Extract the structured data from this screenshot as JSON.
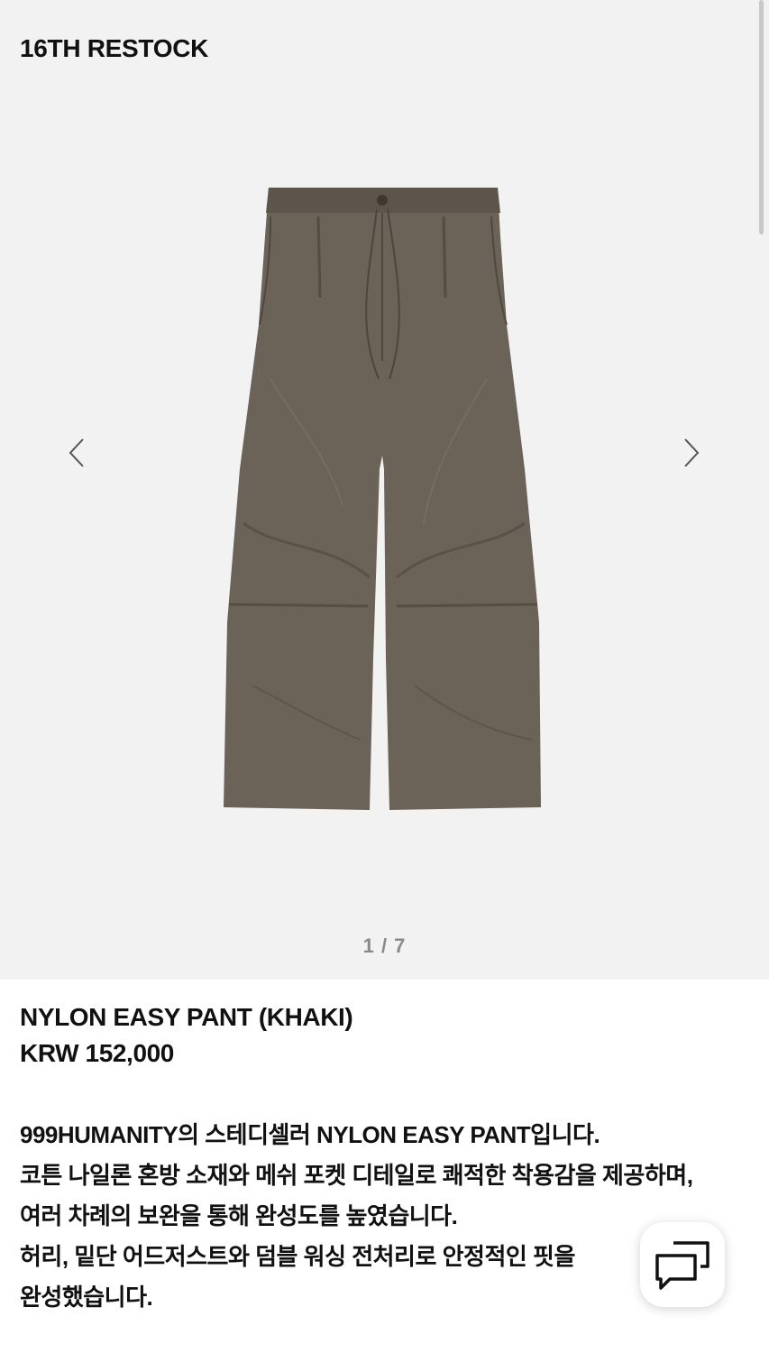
{
  "gallery": {
    "badge": "16TH RESTOCK",
    "counter": "1 / 7",
    "image_icon": "khaki-nylon-pants-photo",
    "fabric_color": "#6b6258"
  },
  "product": {
    "name": "NYLON EASY PANT (KHAKI)",
    "price": "KRW 152,000"
  },
  "description": {
    "lines": [
      "999HUMANITY의 스테디셀러 NYLON EASY PANT입니다.",
      "코튼 나일론 혼방 소재와 메쉬 포켓 디테일로 쾌적한 착용감을 제공하며,",
      "여러 차례의 보완을 통해 완성도를 높였습니다.",
      "허리, 밑단 어드저스트와 덤블 워싱 전처리로 안정적인 핏을",
      "완성했습니다."
    ]
  },
  "icons": {
    "prev": "chevron-left-icon",
    "next": "chevron-right-icon",
    "chat": "chat-bubbles-icon"
  }
}
